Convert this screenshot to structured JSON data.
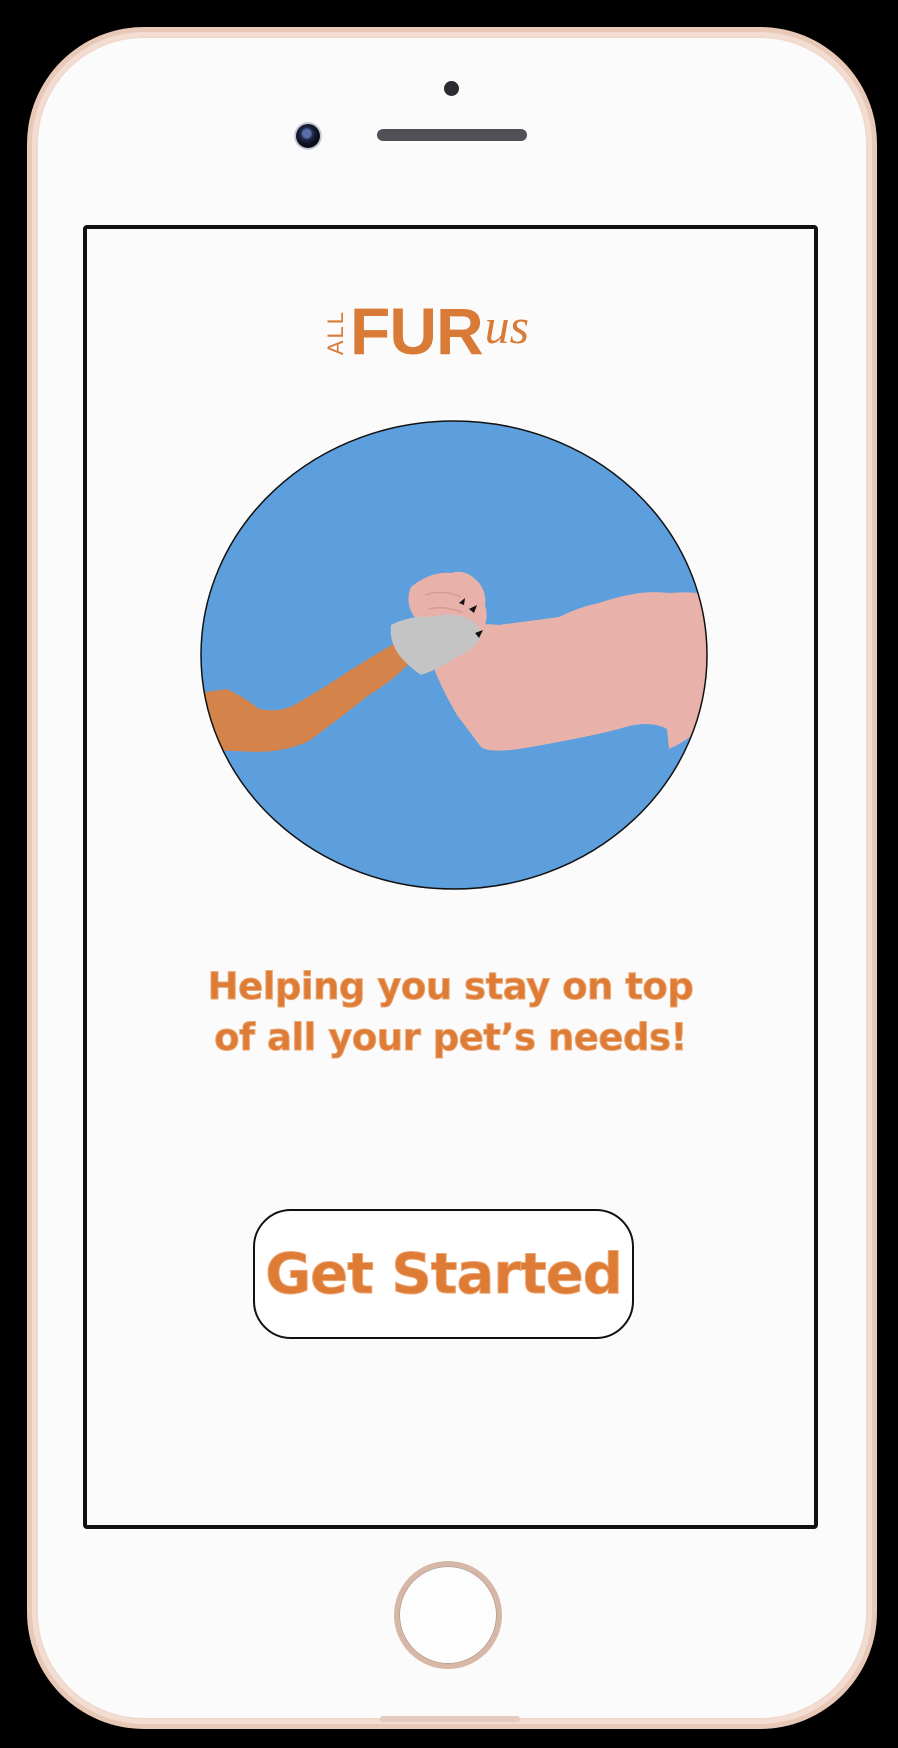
{
  "logo": {
    "all": "ALL",
    "fur": "FUR",
    "us": "us"
  },
  "tagline": {
    "line1": "Helping you stay on top",
    "line2": "of all your pet’s needs!"
  },
  "cta": {
    "label": "Get Started"
  },
  "colors": {
    "brand_orange": "#de7b34",
    "hero_background": "#5d9fdc",
    "human_arm": "#e8b2ab",
    "pet_arm": "#d4844a",
    "paw_grey": "#c4c4c4"
  }
}
